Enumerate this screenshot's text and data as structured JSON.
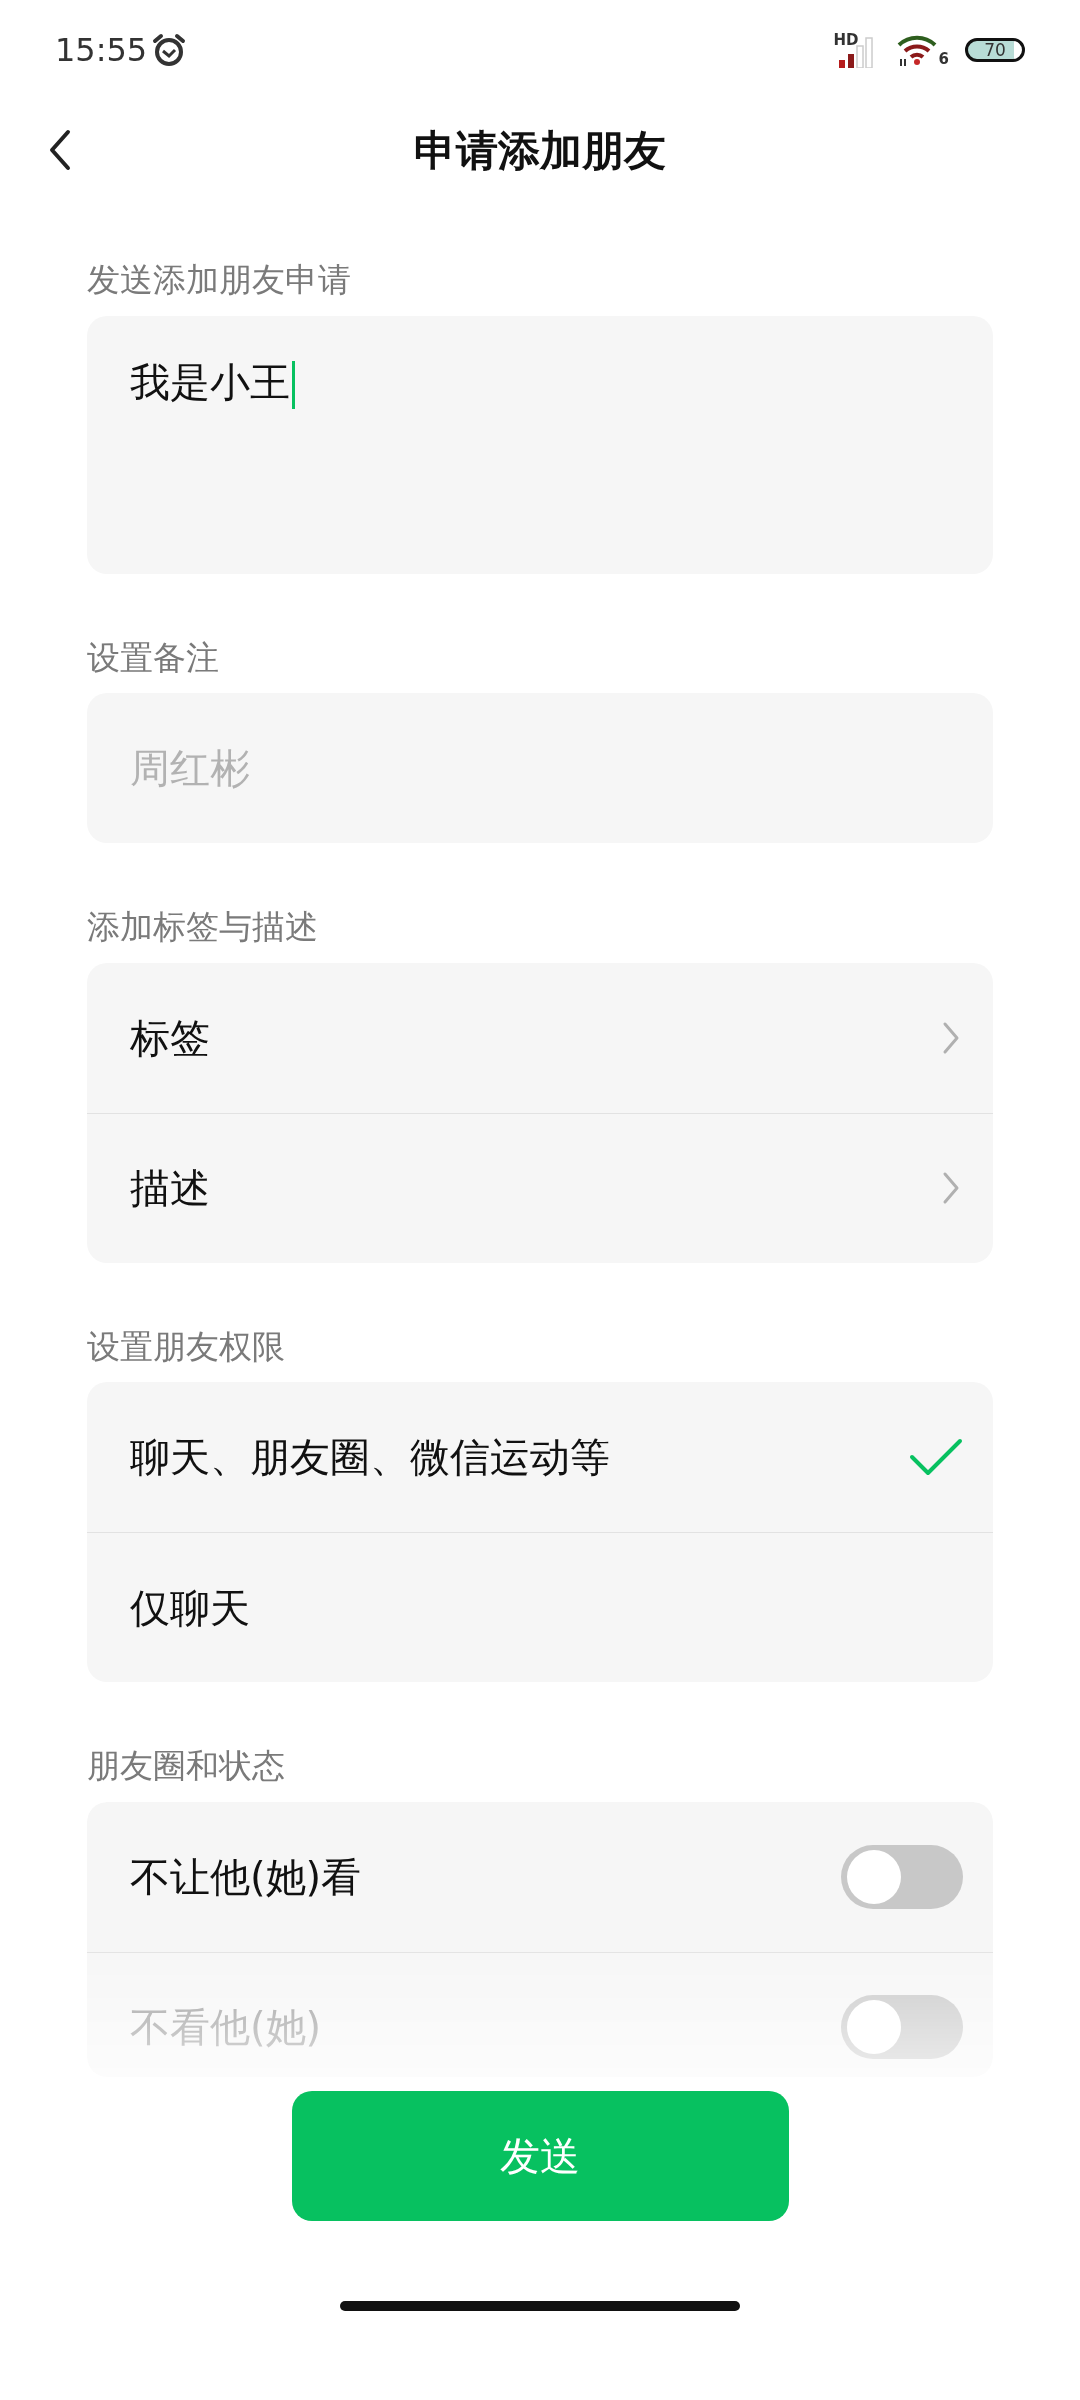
{
  "status_bar": {
    "time": "15:55",
    "network": "HD",
    "wifi": "6",
    "battery": "70"
  },
  "header": {
    "title": "申请添加朋友"
  },
  "sections": [
    {
      "kind": "textarea",
      "label": "发送添加朋友申请",
      "value": "我是小王"
    },
    {
      "kind": "input",
      "label": "设置备注",
      "placeholder": "周红彬"
    },
    {
      "kind": "links",
      "label": "添加标签与描述",
      "items": [
        {
          "label": "标签"
        },
        {
          "label": "描述"
        }
      ]
    },
    {
      "kind": "choices",
      "label": "设置朋友权限",
      "items": [
        {
          "label": "聊天、朋友圈、微信运动等",
          "selected": true
        },
        {
          "label": "仅聊天",
          "selected": false
        }
      ]
    },
    {
      "kind": "toggles",
      "label": "朋友圈和状态",
      "items": [
        {
          "label": "不让他(她)看",
          "on": false
        },
        {
          "label": "不看他(她)",
          "on": false
        }
      ]
    }
  ],
  "send_button": "发送"
}
